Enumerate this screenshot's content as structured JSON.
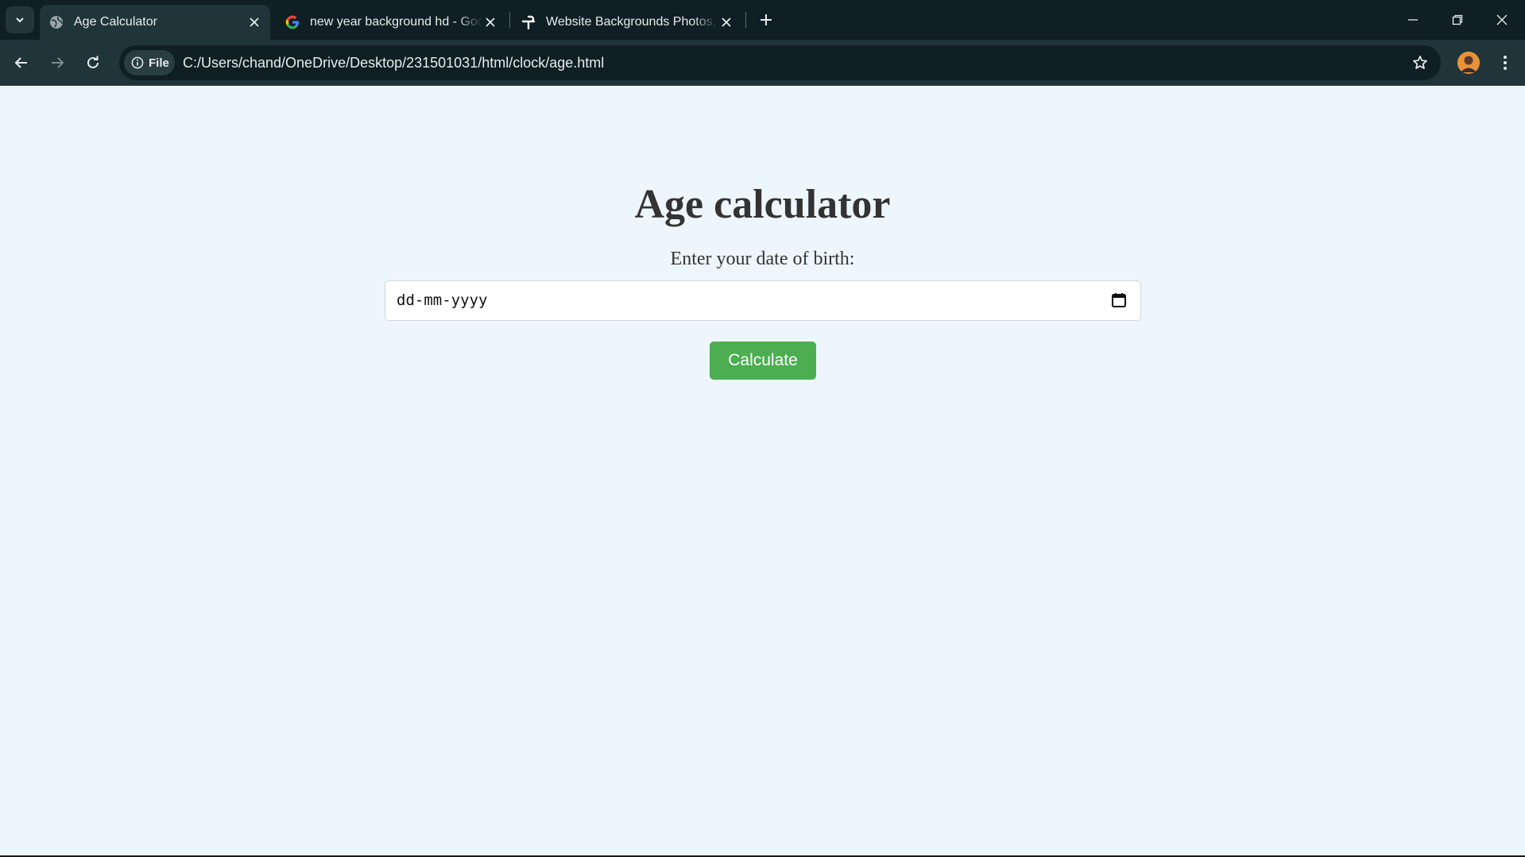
{
  "browser": {
    "tabs": [
      {
        "title": "Age Calculator",
        "active": true,
        "favicon": "globe-icon"
      },
      {
        "title": "new year background hd - Google Search",
        "active": false,
        "favicon": "google-g-icon"
      },
      {
        "title": "Website Backgrounds Photos, Download",
        "active": false,
        "favicon": "pexels-icon"
      }
    ],
    "address_bar": {
      "security_chip": "File",
      "url": "C:/Users/chand/OneDrive/Desktop/231501031/html/clock/age.html"
    },
    "colors": {
      "tabstrip": "#0f1f23",
      "toolbar": "#1f3539"
    }
  },
  "page": {
    "heading": "Age calculator",
    "prompt": "Enter your date of birth:",
    "date_input": {
      "placeholder": "dd-mm-yyyy"
    },
    "button_label": "Calculate",
    "colors": {
      "background": "#eef6fd",
      "button": "#4cae50",
      "text": "#333333"
    }
  }
}
